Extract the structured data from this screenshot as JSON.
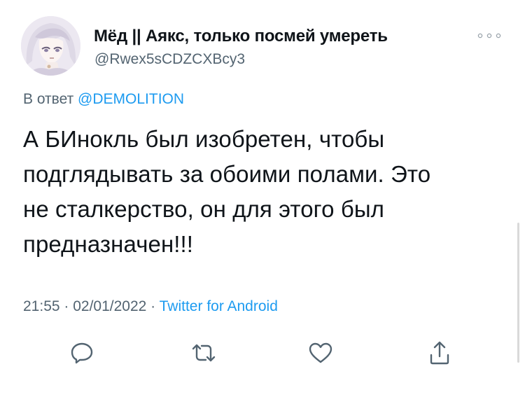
{
  "author": {
    "display_name": "Мёд || Аякс, только посмей умереть",
    "handle": "@Rwex5sCDZCXBcy3"
  },
  "reply": {
    "prefix": "В ответ",
    "mention": "@DEMOLITION"
  },
  "tweet": {
    "text": "А БИнокль был изобретен, чтобы\nподглядывать за обоими полами. Это\nне сталкерство, он для этого был\nпредназначен!!!",
    "time": "21:55",
    "separator1": " · ",
    "date": "02/01/2022",
    "separator2": " · ",
    "source": "Twitter for Android"
  },
  "icons": {
    "more": "more-horizontal-icon",
    "reply": "reply-bubble-icon",
    "retweet": "retweet-icon",
    "like": "heart-icon",
    "share": "share-icon"
  },
  "colors": {
    "text": "#0f1419",
    "secondary": "#536471",
    "accent": "#1d9bf0"
  }
}
